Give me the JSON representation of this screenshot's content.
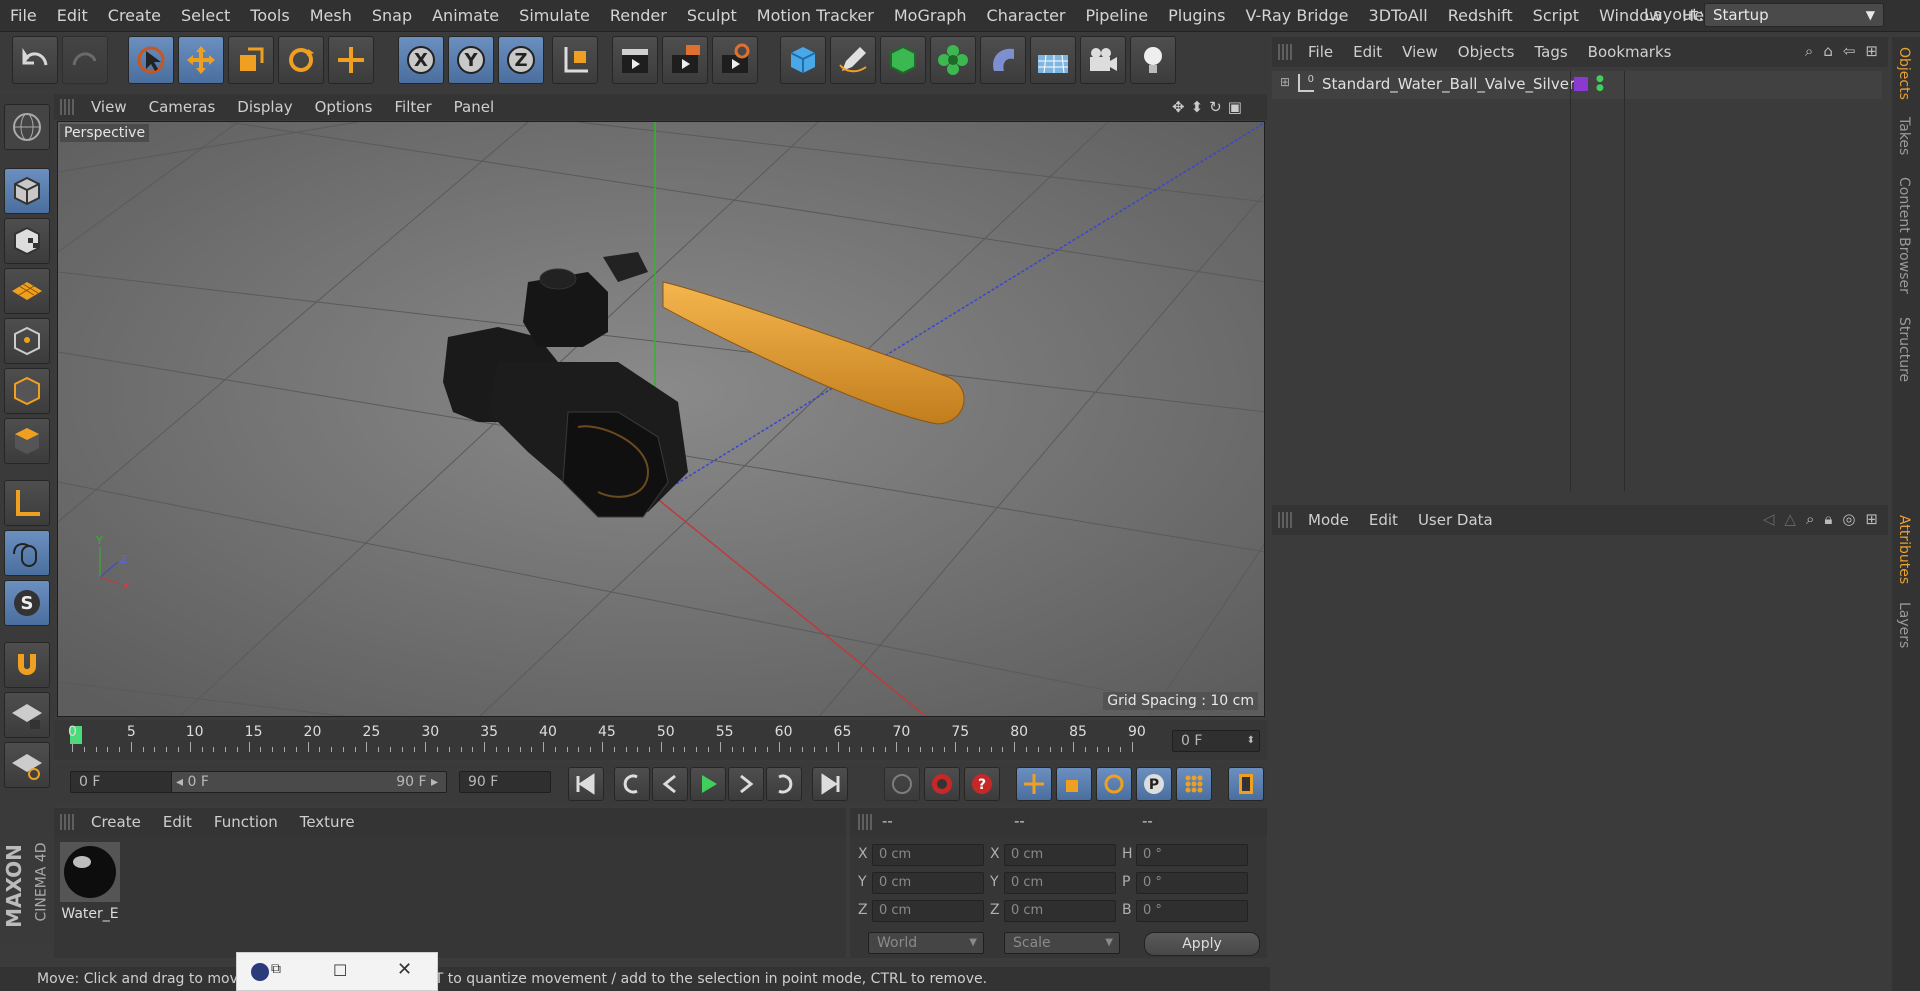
{
  "menubar": {
    "items": [
      "File",
      "Edit",
      "Create",
      "Select",
      "Tools",
      "Mesh",
      "Snap",
      "Animate",
      "Simulate",
      "Render",
      "Sculpt",
      "Motion Tracker",
      "MoGraph",
      "Character",
      "Pipeline",
      "Plugins",
      "V-Ray Bridge",
      "3DToAll",
      "Redshift",
      "Script",
      "Window",
      "Help"
    ],
    "layout_label": "Layout:",
    "layout_value": "Startup"
  },
  "toolbar": {
    "x_label": "X",
    "y_label": "Y",
    "z_label": "Z"
  },
  "viewport": {
    "menu": [
      "View",
      "Cameras",
      "Display",
      "Options",
      "Filter",
      "Panel"
    ],
    "label": "Perspective",
    "grid_spacing": "Grid Spacing : 10 cm",
    "axis_y": "Y",
    "axis_z": "Z",
    "axis_x": "X"
  },
  "timeline": {
    "ticks": [
      "0",
      "5",
      "10",
      "15",
      "20",
      "25",
      "30",
      "35",
      "40",
      "45",
      "50",
      "55",
      "60",
      "65",
      "70",
      "75",
      "80",
      "85",
      "90"
    ],
    "current_frame": "0 F"
  },
  "playbar": {
    "start": "0 F",
    "range_start": "0 F",
    "range_end": "90 F",
    "end": "90 F"
  },
  "material_manager": {
    "menu": [
      "Create",
      "Edit",
      "Function",
      "Texture"
    ],
    "material_name": "Water_E"
  },
  "coords": {
    "headers": [
      "--",
      "--",
      "--"
    ],
    "rows": [
      {
        "a": "X",
        "av": "0 cm",
        "b": "X",
        "bv": "0 cm",
        "c": "H",
        "cv": "0 °"
      },
      {
        "a": "Y",
        "av": "0 cm",
        "b": "Y",
        "bv": "0 cm",
        "c": "P",
        "cv": "0 °"
      },
      {
        "a": "Z",
        "av": "0 cm",
        "b": "Z",
        "bv": "0 cm",
        "c": "B",
        "cv": "0 °"
      }
    ],
    "world": "World",
    "scale": "Scale",
    "apply": "Apply"
  },
  "status": {
    "text": "Move: Click and drag to move elements. Hold down SHIFT to quantize movement / add to the selection in point mode, CTRL to remove."
  },
  "objects_panel": {
    "menu": [
      "File",
      "Edit",
      "View",
      "Objects",
      "Tags",
      "Bookmarks"
    ],
    "object_name": "Standard_Water_Ball_Valve_Silver"
  },
  "attributes_panel": {
    "menu": [
      "Mode",
      "Edit",
      "User Data"
    ]
  },
  "side_tabs": {
    "objects": "Objects",
    "takes": "Takes",
    "content_browser": "Content Browser",
    "structure": "Structure",
    "attributes": "Attributes",
    "layers": "Layers"
  },
  "brand": {
    "maxon": "MAXON",
    "cinema": "CINEMA 4D"
  },
  "colors": {
    "accent_orange": "#e8a030",
    "selected_blue": "#5b7fb0",
    "axis_red": "#c03030",
    "axis_green": "#30b030",
    "axis_blue": "#3040c0"
  }
}
